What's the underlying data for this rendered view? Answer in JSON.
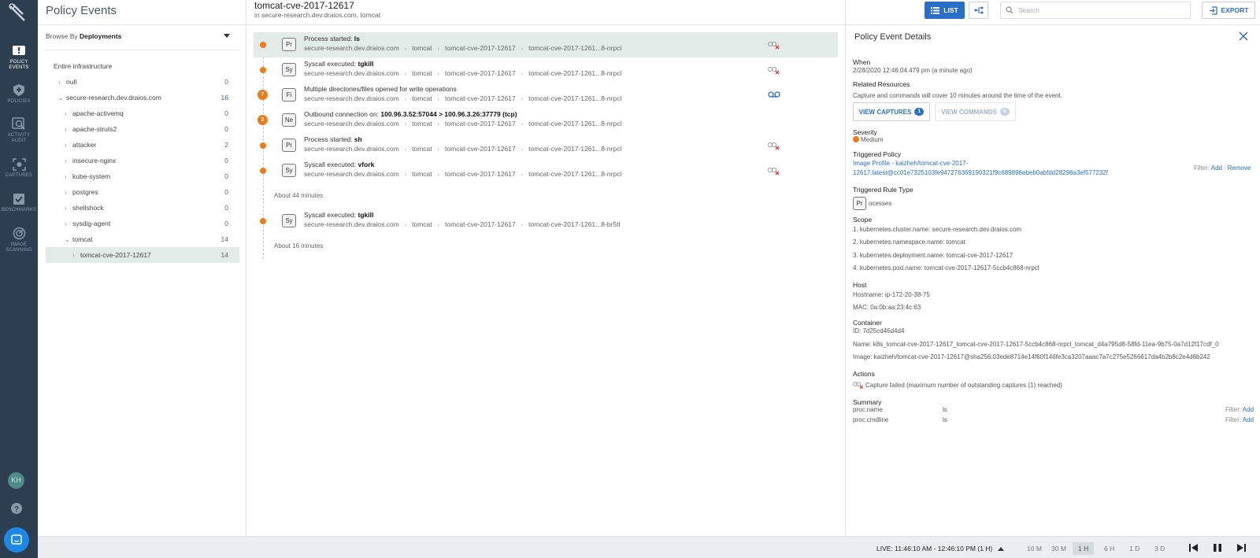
{
  "page_title": "Policy Events",
  "rail": {
    "items": [
      {
        "icon": "policy-events-icon",
        "label_1": "POLICY",
        "label_2": "EVENTS"
      },
      {
        "icon": "policies-icon",
        "label_1": "POLICIES",
        "label_2": ""
      },
      {
        "icon": "activity-audit-icon",
        "label_1": "ACTIVITY",
        "label_2": "AUDIT"
      },
      {
        "icon": "captures-icon",
        "label_1": "CAPTURES",
        "label_2": ""
      },
      {
        "icon": "benchmarks-icon",
        "label_1": "BENCHMARKS",
        "label_2": ""
      },
      {
        "icon": "image-scanning-icon",
        "label_1": "IMAGE",
        "label_2": "SCANNING"
      }
    ],
    "avatar": "KH"
  },
  "header": {
    "title": "tomcat-cve-2017-12617",
    "subtitle": "in secure-research.dev.draios.com, tomcat",
    "list_label": "LIST",
    "search_placeholder": "Search",
    "export_label": "EXPORT"
  },
  "browse": {
    "prefix": "Browse By",
    "value": "Deployments"
  },
  "tree": [
    {
      "label": "Entire infrastructure",
      "count": "",
      "indent": 0,
      "twisty": ""
    },
    {
      "label": "null",
      "count": "0",
      "indent": 1,
      "twisty": "›"
    },
    {
      "label": "secure-research.dev.draios.com",
      "count": "16",
      "indent": 1,
      "twisty": "⌄"
    },
    {
      "label": "apache-activemq",
      "count": "0",
      "indent": 2,
      "twisty": "›"
    },
    {
      "label": "apache-struts2",
      "count": "0",
      "indent": 2,
      "twisty": "›"
    },
    {
      "label": "attacker",
      "count": "2",
      "indent": 2,
      "twisty": "›"
    },
    {
      "label": "insecure-nginx",
      "count": "0",
      "indent": 2,
      "twisty": "›"
    },
    {
      "label": "kube-system",
      "count": "0",
      "indent": 2,
      "twisty": "›"
    },
    {
      "label": "postgres",
      "count": "0",
      "indent": 2,
      "twisty": "›"
    },
    {
      "label": "shellshock",
      "count": "0",
      "indent": 2,
      "twisty": "›"
    },
    {
      "label": "sysdig-agent",
      "count": "0",
      "indent": 2,
      "twisty": "›"
    },
    {
      "label": "tomcat",
      "count": "14",
      "indent": 2,
      "twisty": "⌄"
    },
    {
      "label": "tomcat-cve-2017-12617",
      "count": "14",
      "indent": 3,
      "twisty": "›"
    }
  ],
  "events": [
    {
      "tag": "Pr",
      "title": "Process started: ",
      "bold": "ls",
      "path": [
        "secure-research.dev.draios.com",
        "tomcat",
        "tomcat-cve-2017-12617",
        "tomcat-cve-2017-1261...8-nrpcl"
      ],
      "dot": "",
      "action": "capture-failed-icon"
    },
    {
      "tag": "Sy",
      "title": "Syscall executed: ",
      "bold": "tgkill",
      "path": [
        "secure-research.dev.draios.com",
        "tomcat",
        "tomcat-cve-2017-12617",
        "tomcat-cve-2017-1261...8-nrpcl"
      ],
      "dot": "",
      "action": "capture-failed-icon"
    },
    {
      "tag": "Fi",
      "title": "Multiple directories/files opened for write operations",
      "bold": "",
      "path": [
        "secure-research.dev.draios.com",
        "tomcat",
        "tomcat-cve-2017-12617",
        "tomcat-cve-2017-1261...8-nrpcl"
      ],
      "dot": "7",
      "action": "recording-icon"
    },
    {
      "tag": "Ne",
      "title": "Outbound connection on: ",
      "bold": "100.96.3.52:57044 > 100.96.3.26:37779 (tcp)",
      "path": [
        "secure-research.dev.draios.com",
        "tomcat",
        "tomcat-cve-2017-12617",
        "tomcat-cve-2017-1261...8-nrpcl"
      ],
      "dot": "2",
      "action": ""
    },
    {
      "tag": "Pr",
      "title": "Process started: ",
      "bold": "sh",
      "path": [
        "secure-research.dev.draios.com",
        "tomcat",
        "tomcat-cve-2017-12617",
        "tomcat-cve-2017-1261...8-nrpcl"
      ],
      "dot": "",
      "action": "capture-failed-icon"
    },
    {
      "tag": "Sy",
      "title": "Syscall executed: ",
      "bold": "vfork",
      "path": [
        "secure-research.dev.draios.com",
        "tomcat",
        "tomcat-cve-2017-12617",
        "tomcat-cve-2017-1261...8-nrpcl"
      ],
      "dot": "",
      "action": "capture-failed-icon"
    },
    {
      "tag": "Sy",
      "title": "Syscall executed: ",
      "bold": "tgkill",
      "path": [
        "secure-research.dev.draios.com",
        "tomcat",
        "tomcat-cve-2017-12617",
        "tomcat-cve-2017-1261...8-br5tl"
      ],
      "dot": "",
      "action": ""
    }
  ],
  "gaps": [
    "About 44 minutes",
    "About 16 minutes"
  ],
  "details": {
    "title": "Policy Event Details",
    "when_label": "When",
    "when_value": "2/28/2020 12:46:04.479 pm (a minute ago)",
    "related_label": "Related Resources",
    "related_note": "Capture and commands will cover 10 minutes around the time of the event.",
    "view_captures": "VIEW CAPTURES",
    "captures_count": "1",
    "view_commands": "VIEW COMMANDS",
    "commands_count": "0",
    "severity_label": "Severity",
    "severity_value": "Medium",
    "triggered_policy_label": "Triggered Policy",
    "policy_line1": "Image Profile - kaizheh/tomcat-cve-2017-",
    "policy_line2": "12617:latest@cc01e7325103fe947276369190321f9c689896ebeb0abfdd28298a3ef577232f",
    "filter_label": "Filter:",
    "filter_add": "Add",
    "filter_remove": "Remove",
    "rule_type_label": "Triggered Rule Type",
    "rule_tag": "Pr",
    "rule_type_value": "ocesses",
    "scope_label": "Scope",
    "scope": [
      "1. kubernetes.cluster.name: secure-research.dev.draios.com",
      "2. kubernetes.namespace.name: tomcat",
      "3. kubernetes.deployment.name: tomcat-cve-2017-12617",
      "4. kubernetes.pod.name: tomcat-cve-2017-12617-5ccb4c868-nrpcl"
    ],
    "host_label": "Host",
    "hostname": "Hostname: ip-172-20-38-75",
    "mac": "MAC: 0a:0b:aa:23:4c:63",
    "container_label": "Container",
    "container_id": "ID: 7d25cd46d4d4",
    "container_name": "Name: k8s_tomcat-cve-2017-12617_tomcat-cve-2017-12617-5ccb4c868-nrpcl_tomcat_d4a795d8-58fd-11ea-9b75-0a7d12f17cdf_0",
    "container_image": "Image: kaizheh/tomcat-cve-2017-12617@sha256:03ede8714e14f60f146fe3ca3207aaac7a7c275e5266617da4b2b8c2e4d6b242",
    "actions_label": "Actions",
    "action_text": "Capture failed (maximum number of outstanding captures (1) reached)",
    "summary_label": "Summary",
    "summary": [
      {
        "key": "proc.name",
        "value": "ls",
        "filter": "Filter:",
        "add": "Add"
      },
      {
        "key": "proc.cmdline",
        "value": "ls",
        "filter": "Filter:",
        "add": "Add"
      }
    ]
  },
  "bottom": {
    "live": "LIVE: 11:46:10 AM - 12:46:10 PM (1 H)",
    "ranges": [
      "10 M",
      "30 M",
      "1 H",
      "6 H",
      "1 D",
      "3 D"
    ],
    "selected_range": "1 H"
  },
  "colors": {
    "rail": "#2d3e50",
    "accent": "#2a6fc7",
    "severity_medium": "#f07a1a",
    "selected_row": "#e2ebe8"
  }
}
